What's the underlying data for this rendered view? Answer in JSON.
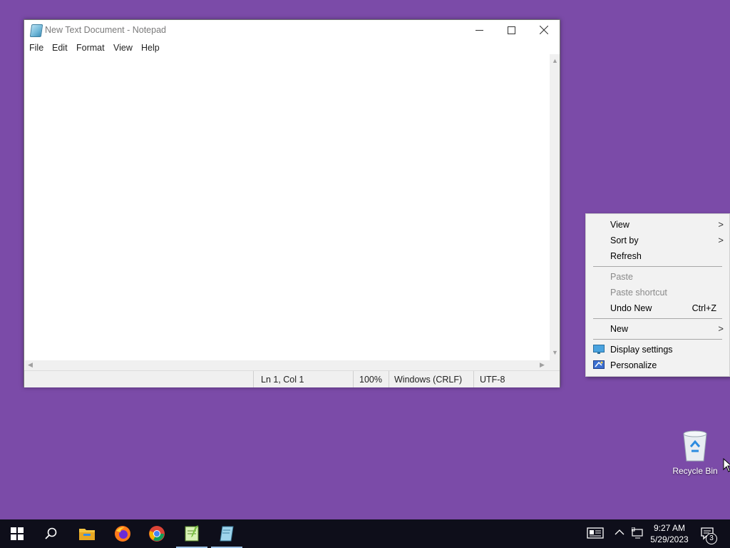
{
  "desktop": {
    "background": "#7b4ba8"
  },
  "notepad": {
    "title": "New Text Document - Notepad",
    "menu": [
      "File",
      "Edit",
      "Format",
      "View",
      "Help"
    ],
    "content": "",
    "status": {
      "position": "Ln 1, Col 1",
      "zoom": "100%",
      "line_ending": "Windows (CRLF)",
      "encoding": "UTF-8"
    }
  },
  "context_menu": {
    "items": [
      {
        "label": "View",
        "submenu": true,
        "enabled": true
      },
      {
        "label": "Sort by",
        "submenu": true,
        "enabled": true
      },
      {
        "label": "Refresh",
        "enabled": true
      },
      {
        "label": "Paste",
        "enabled": false
      },
      {
        "label": "Paste shortcut",
        "enabled": false
      },
      {
        "label": "Undo New",
        "shortcut": "Ctrl+Z",
        "enabled": true
      },
      {
        "label": "New",
        "submenu": true,
        "enabled": true
      },
      {
        "label": "Display settings",
        "icon": "display-icon",
        "enabled": true
      },
      {
        "label": "Personalize",
        "icon": "personalize-icon",
        "enabled": true
      }
    ]
  },
  "desktop_icons": [
    {
      "label": "Recycle Bin",
      "icon": "recycle-bin-icon"
    }
  ],
  "taskbar": {
    "apps": [
      "start",
      "search",
      "file-explorer",
      "firefox",
      "chrome",
      "notepadplusplus",
      "notepad"
    ],
    "time": "9:27 AM",
    "date": "5/29/2023",
    "notification_count": "3"
  }
}
